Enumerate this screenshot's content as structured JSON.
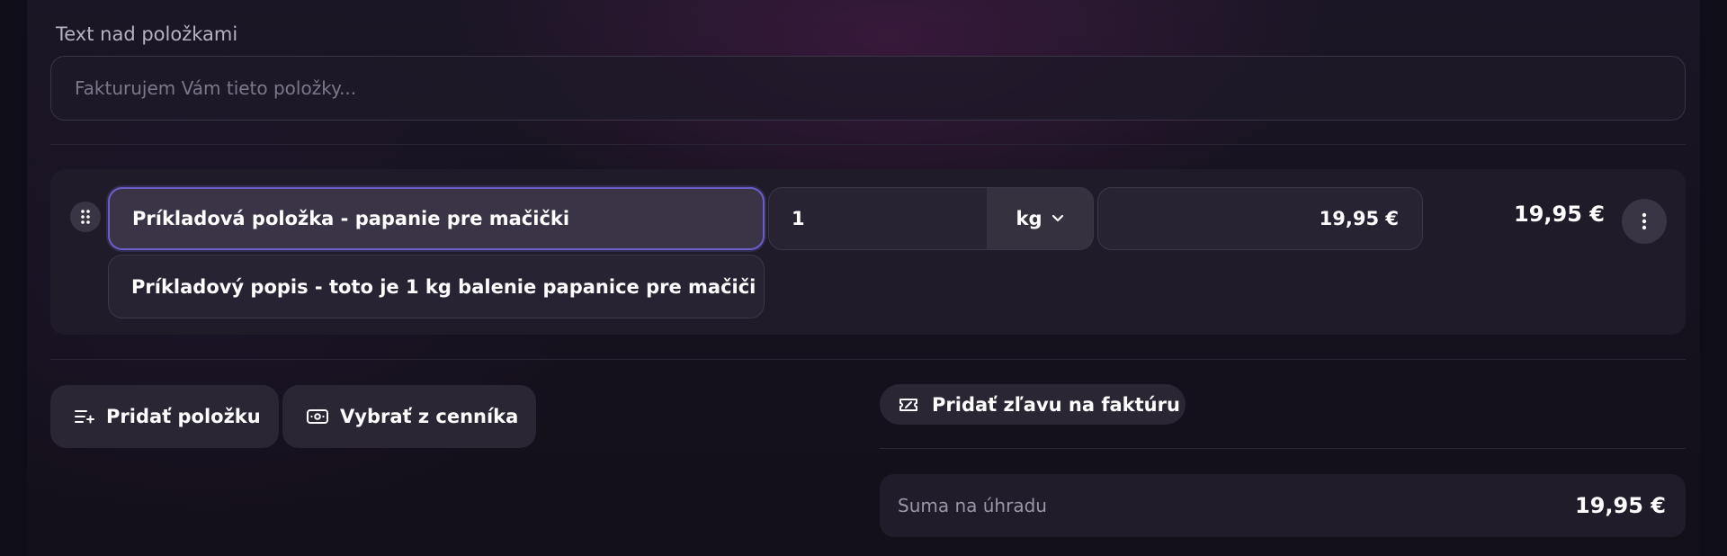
{
  "intro": {
    "label": "Text nad položkami",
    "placeholder": "Fakturujem Vám tieto položky..."
  },
  "items": [
    {
      "name": "Príkladová položka - papanie pre mačički",
      "description": "Príkladový popis - toto je 1 kg balenie papanice pre mačiči",
      "quantity": "1",
      "unit": "kg",
      "unit_price": "19,95 €",
      "total": "19,95 €"
    }
  ],
  "actions": {
    "add_item": "Pridať položku",
    "from_price_list": "Vybrať z cenníka",
    "add_discount": "Pridať zľavu na faktúru"
  },
  "summary": {
    "label": "Suma na úhradu",
    "value": "19,95 €"
  },
  "icons": {
    "drag": "drag-handle-icon",
    "unit_dropdown": "chevron-down-icon",
    "more": "more-vertical-icon",
    "add_item": "list-add-icon",
    "price_list": "banknote-icon",
    "discount": "ticket-icon"
  },
  "colors": {
    "focus_border": "#6b5fc7",
    "background": "#16121f"
  }
}
